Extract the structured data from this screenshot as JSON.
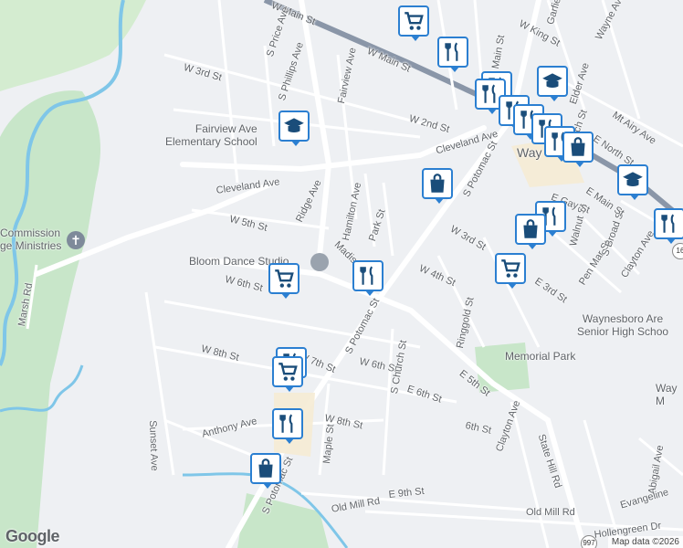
{
  "map": {
    "streets": [
      {
        "name": "W Main St"
      },
      {
        "name": "W Main St"
      },
      {
        "name": "N Main St"
      },
      {
        "name": "S Price Ave"
      },
      {
        "name": "S Phillips Ave"
      },
      {
        "name": "Fairview Ave"
      },
      {
        "name": "W 3rd St"
      },
      {
        "name": "W 2nd St"
      },
      {
        "name": "Cleveland Ave"
      },
      {
        "name": "Cleveland Ave"
      },
      {
        "name": "Ridge Ave"
      },
      {
        "name": "Hamilton Ave"
      },
      {
        "name": "W 5th St"
      },
      {
        "name": "Park St"
      },
      {
        "name": "Madison"
      },
      {
        "name": "W 6th St"
      },
      {
        "name": "W 6th St"
      },
      {
        "name": "S Potomac St"
      },
      {
        "name": "S Potomac St"
      },
      {
        "name": "W 7th St"
      },
      {
        "name": "W 8th St"
      },
      {
        "name": "W 8th St"
      },
      {
        "name": "Anthony Ave"
      },
      {
        "name": "Sunset Ave"
      },
      {
        "name": "Maple St"
      },
      {
        "name": "Old Mill Rd"
      },
      {
        "name": "Old Mill Rd"
      },
      {
        "name": "E 9th St"
      },
      {
        "name": "S Potomac St"
      },
      {
        "name": "E 5th St"
      },
      {
        "name": "E 6th St"
      },
      {
        "name": "6th St"
      },
      {
        "name": "S Church St"
      },
      {
        "name": "Ringgold St"
      },
      {
        "name": "W 4th St"
      },
      {
        "name": "W 3rd St"
      },
      {
        "name": "Clayton Ave"
      },
      {
        "name": "Clayton Ave"
      },
      {
        "name": "State Hill Rd"
      },
      {
        "name": "Pen Mar St"
      },
      {
        "name": "S Broad St"
      },
      {
        "name": "E Main St"
      },
      {
        "name": "Walnut St"
      },
      {
        "name": "E 3rd St"
      },
      {
        "name": "E North St"
      },
      {
        "name": "Mt Airy Ave"
      },
      {
        "name": "Wayne Ave"
      },
      {
        "name": "W King St"
      },
      {
        "name": "Elder Ave"
      },
      {
        "name": "Abigail Ave"
      },
      {
        "name": "Evangeline"
      },
      {
        "name": "Hollengreen Dr"
      },
      {
        "name": "Marsh Rd"
      },
      {
        "name": "Garfield"
      },
      {
        "name": "N Church St"
      },
      {
        "name": "E Gay St"
      }
    ],
    "places": {
      "school1": "Fairview Ave\nElementary School",
      "commission": "Commission\nge Ministries",
      "dance": "Bloom Dance Studio",
      "park": "Memorial Park",
      "highschool": "Waynesboro Are\nSenior High Schoo",
      "town": "Way",
      "way2": "Way\nM"
    },
    "route_numbers": [
      "16",
      "997"
    ],
    "pins": [
      {
        "icon": "shopping-cart-icon"
      },
      {
        "icon": "restaurant-icon"
      },
      {
        "icon": "restaurant-icon"
      },
      {
        "icon": "school-icon"
      },
      {
        "icon": "restaurant-icon"
      },
      {
        "icon": "restaurant-icon"
      },
      {
        "icon": "restaurant-icon"
      },
      {
        "icon": "restaurant-icon"
      },
      {
        "icon": "restaurant-icon"
      },
      {
        "icon": "shopping-bag-icon"
      },
      {
        "icon": "school-icon"
      },
      {
        "icon": "shopping-bag-icon"
      },
      {
        "icon": "restaurant-icon"
      },
      {
        "icon": "shopping-bag-icon"
      },
      {
        "icon": "shopping-cart-icon"
      },
      {
        "icon": "restaurant-icon"
      },
      {
        "icon": "shopping-cart-icon"
      },
      {
        "icon": "restaurant-icon"
      },
      {
        "icon": "shopping-cart-icon"
      },
      {
        "icon": "restaurant-icon"
      },
      {
        "icon": "shopping-bag-icon"
      },
      {
        "icon": "school-icon"
      },
      {
        "icon": "restaurant-icon"
      }
    ],
    "pin_color": "#2b7fd1",
    "water_color": "#7fc6e8",
    "park_color": "#c8e6c9",
    "road_color": "#ffffff",
    "highway_color": "#8a96a8"
  },
  "branding": {
    "logo": "Google",
    "attribution": "Map data ©2026"
  }
}
